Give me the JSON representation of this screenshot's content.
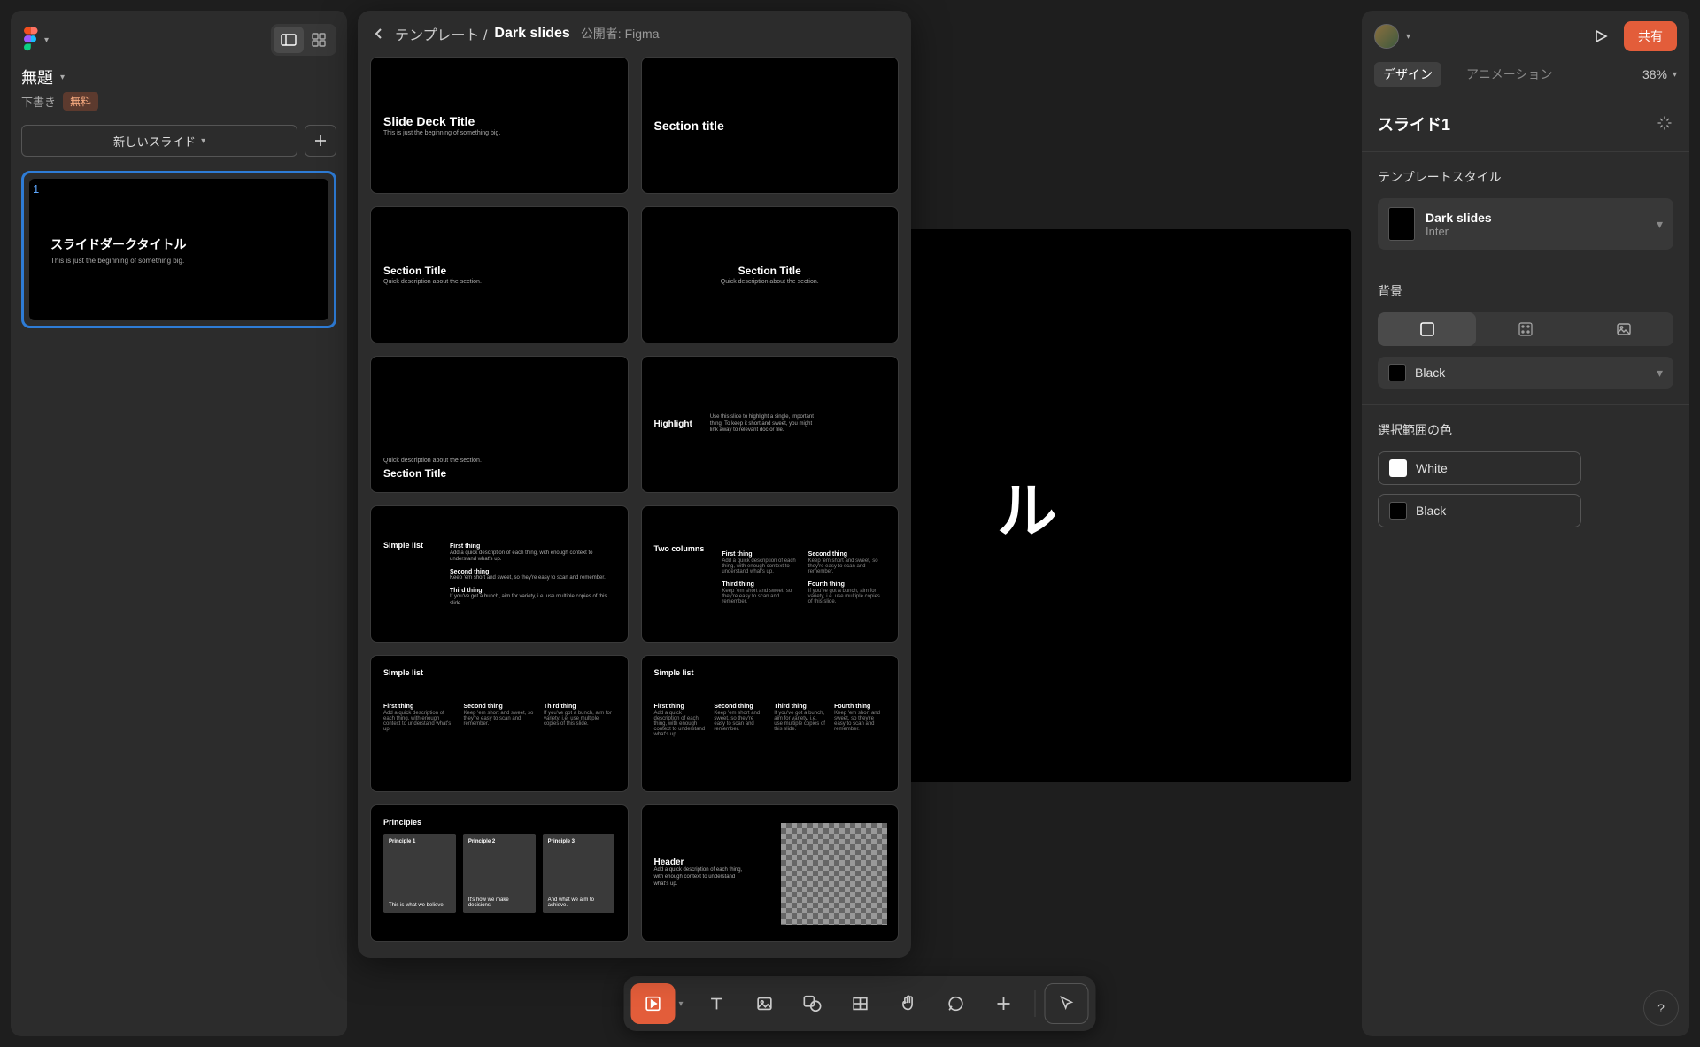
{
  "document": {
    "title": "無題",
    "status": "下書き",
    "plan_badge": "無料"
  },
  "left_panel": {
    "new_slide": "新しいスライド",
    "slide_number": "1",
    "slide_title": "スライドダークタイトル",
    "slide_subtitle": "This is just the beginning of something big."
  },
  "template_panel": {
    "breadcrumb": "テンプレート /",
    "name": "Dark slides",
    "publisher_label": "公開者:",
    "publisher": "Figma",
    "cards": [
      {
        "title": "Slide Deck Title",
        "sub": "This is just the beginning of something big."
      },
      {
        "title": "Section title"
      },
      {
        "title": "Section Title",
        "sub": "Quick description about the section."
      },
      {
        "title": "Section Title",
        "sub": "Quick description about the section."
      },
      {
        "sub": "Quick description about the section.",
        "title": "Section Title"
      },
      {
        "title": "Highlight",
        "body": "Use this slide to highlight a single, important thing. To keep it short and sweet, you might link away to relevant doc or file."
      },
      {
        "title": "Simple list",
        "items": [
          "First thing",
          "Second thing",
          "Third thing"
        ]
      },
      {
        "title": "Two columns",
        "cols": [
          "First thing",
          "Second thing",
          "Third thing",
          "Fourth thing"
        ]
      },
      {
        "title": "Simple list",
        "cols3": [
          "First thing",
          "Second thing",
          "Third thing"
        ]
      },
      {
        "title": "Simple list",
        "cols4": [
          "First thing",
          "Second thing",
          "Third thing",
          "Fourth thing"
        ]
      },
      {
        "title": "Principles",
        "p": [
          {
            "h": "Principle 1",
            "b": "This is what we believe."
          },
          {
            "h": "Principle 2",
            "b": "It's how we make decisions."
          },
          {
            "h": "Principle 3",
            "b": "And what we aim to achieve."
          }
        ]
      },
      {
        "title": "Header",
        "sub": "Add a quick description of each thing, with enough context to understand what's up."
      }
    ]
  },
  "canvas": {
    "visible_text": "ル"
  },
  "right_panel": {
    "share": "共有",
    "tabs": {
      "design": "デザイン",
      "animation": "アニメーション"
    },
    "zoom": "38%",
    "slide_label": "スライド1",
    "template_style_label": "テンプレートスタイル",
    "style_name": "Dark slides",
    "style_font": "Inter",
    "background_label": "背景",
    "bg_color_name": "Black",
    "bg_color_hex": "#000000",
    "selection_label": "選択範囲の色",
    "sel_colors": [
      {
        "name": "White",
        "hex": "#ffffff"
      },
      {
        "name": "Black",
        "hex": "#000000"
      }
    ]
  },
  "toolbar": {
    "items": [
      "move",
      "text",
      "image",
      "shape",
      "table",
      "hand",
      "comment",
      "add",
      "cursor"
    ]
  },
  "micro": {
    "desc": "Add a quick description of each thing, with enough context to understand what's up.",
    "keep": "Keep 'em short and sweet, so they're easy to scan and remember.",
    "goal": "If you've got a bunch, aim for variety, i.e. use multiple copies of this slide."
  }
}
